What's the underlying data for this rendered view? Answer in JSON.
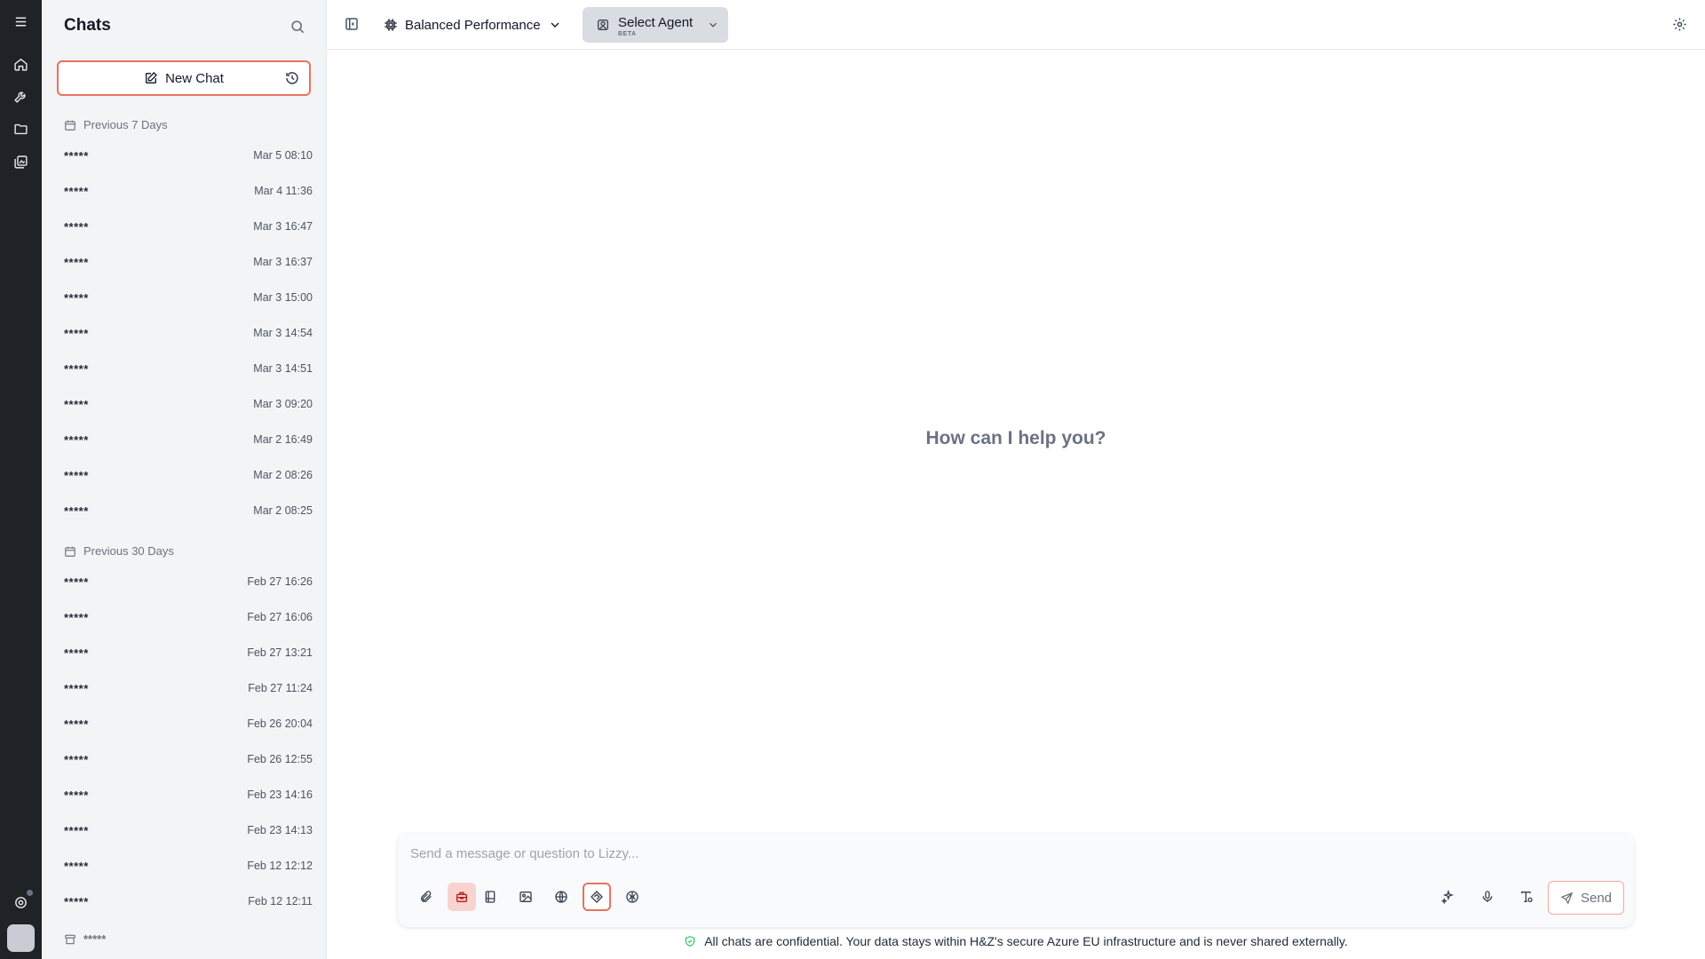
{
  "sidebar": {
    "title": "Chats",
    "new_chat_label": "New Chat",
    "sections": [
      {
        "label": "Previous 7 Days",
        "items": [
          {
            "name": "*****",
            "date": "Mar 5 08:10"
          },
          {
            "name": "*****",
            "date": "Mar 4 11:36"
          },
          {
            "name": "*****",
            "date": "Mar 3 16:47"
          },
          {
            "name": "*****",
            "date": "Mar 3 16:37"
          },
          {
            "name": "*****",
            "date": "Mar 3 15:00"
          },
          {
            "name": "*****",
            "date": "Mar 3 14:54"
          },
          {
            "name": "*****",
            "date": "Mar 3 14:51"
          },
          {
            "name": "*****",
            "date": "Mar 3 09:20"
          },
          {
            "name": "*****",
            "date": "Mar 2 16:49"
          },
          {
            "name": "*****",
            "date": "Mar 2 08:26"
          },
          {
            "name": "*****",
            "date": "Mar 2 08:25"
          }
        ]
      },
      {
        "label": "Previous 30 Days",
        "items": [
          {
            "name": "*****",
            "date": "Feb 27 16:26"
          },
          {
            "name": "*****",
            "date": "Feb 27 16:06"
          },
          {
            "name": "*****",
            "date": "Feb 27 13:21"
          },
          {
            "name": "*****",
            "date": "Feb 27 11:24"
          },
          {
            "name": "*****",
            "date": "Feb 26 20:04"
          },
          {
            "name": "*****",
            "date": "Feb 26 12:55"
          },
          {
            "name": "*****",
            "date": "Feb 23 14:16"
          },
          {
            "name": "*****",
            "date": "Feb 23 14:13"
          },
          {
            "name": "*****",
            "date": "Feb 12 12:12"
          },
          {
            "name": "*****",
            "date": "Feb 12 12:11"
          }
        ]
      }
    ],
    "last_item_label": "*****"
  },
  "topbar": {
    "model_label": "Balanced Performance",
    "agent_label": "Select Agent",
    "agent_badge": "BETA"
  },
  "main": {
    "greeting": "How can I help you?"
  },
  "composer": {
    "placeholder": "Send a message or question to Lizzy...",
    "send_label": "Send"
  },
  "disclaimer": "All chats are confidential. Your data stays within H&Z's secure Azure EU infrastructure and is never shared externally.",
  "colors": {
    "accent": "#e8735f",
    "rail": "#1f2328",
    "sidebar": "#f3f4f6"
  }
}
